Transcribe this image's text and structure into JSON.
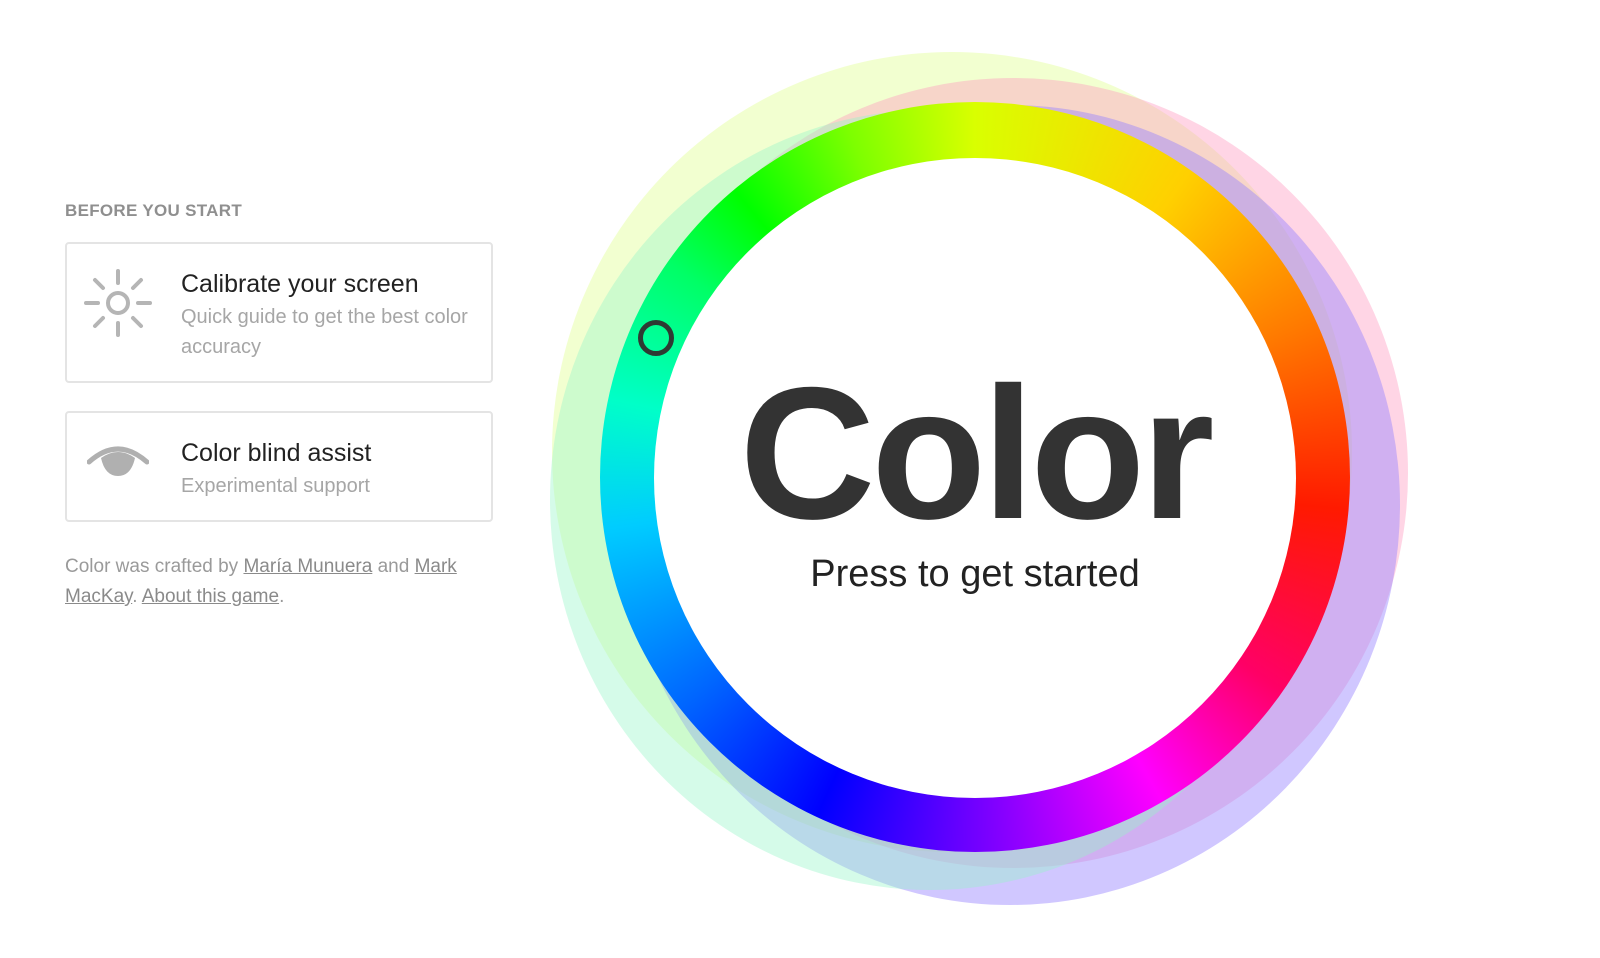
{
  "sidebar": {
    "heading": "BEFORE YOU START",
    "calibrate": {
      "icon": "sun-icon",
      "title": "Calibrate your screen",
      "subtitle": "Quick guide to get the best color accuracy"
    },
    "colorblind": {
      "icon": "eye-icon",
      "title": "Color blind assist",
      "subtitle": "Experimental support"
    },
    "credits": {
      "prefix": "Color was crafted by",
      "author1": "María Munuera",
      "and": "and",
      "author2": "Mark MacKay",
      "period1": ".",
      "about": "About this game",
      "period2": "."
    }
  },
  "game": {
    "title": "Color",
    "subtitle": "Press to get started",
    "picker_icon": "circle-handle"
  },
  "colors": {
    "heading": "#8f8f8f",
    "title_text": "#333333",
    "card_border": "#e4e4e4",
    "picker_handle": "#2e3a33"
  }
}
